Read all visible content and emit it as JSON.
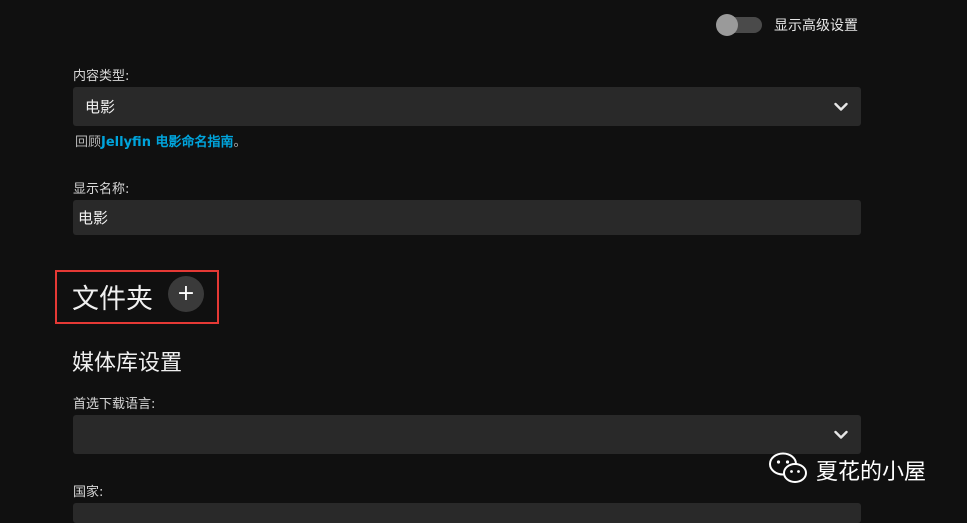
{
  "advanced_toggle": {
    "label": "显示高级设置",
    "state": "off"
  },
  "content_type": {
    "label": "内容类型:",
    "value": "电影"
  },
  "naming_hint": {
    "prefix": "回顾",
    "link": "Jellyfin 电影命名指南",
    "suffix": "。"
  },
  "display_name": {
    "label": "显示名称:",
    "value": "电影"
  },
  "folders": {
    "title": "文件夹",
    "add_label": "+"
  },
  "library_settings": {
    "title": "媒体库设置"
  },
  "download_language": {
    "label": "首选下载语言:",
    "value": ""
  },
  "country": {
    "label": "国家:"
  },
  "watermark": {
    "text": "夏花的小屋",
    "icon": "wechat-icon"
  }
}
